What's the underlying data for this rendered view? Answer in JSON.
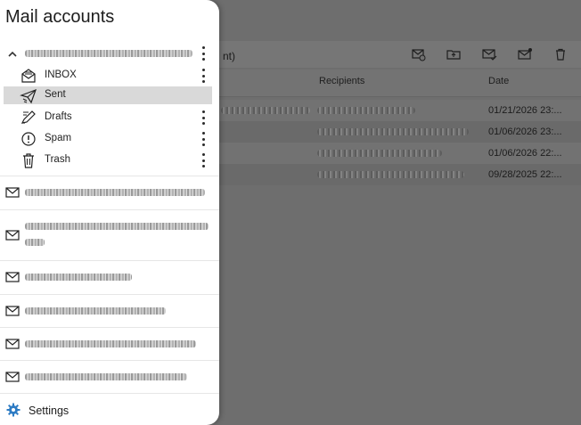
{
  "drawer": {
    "title": "Mail accounts",
    "primary_account": {
      "folders": [
        {
          "label": "INBOX",
          "icon": "inbox-icon"
        },
        {
          "label": "Sent",
          "icon": "sent-icon",
          "selected": true
        },
        {
          "label": "Drafts",
          "icon": "drafts-icon"
        },
        {
          "label": "Spam",
          "icon": "spam-icon"
        },
        {
          "label": "Trash",
          "icon": "trash-icon"
        }
      ]
    },
    "other_accounts_count": 6,
    "settings_label": "Settings",
    "settings_icon": "gear-icon"
  },
  "background": {
    "folder_title_fragment": "nt)",
    "toolbar_icons": [
      "move-to-junk-icon",
      "move-to-folder-icon",
      "mark-read-icon",
      "mark-unread-icon",
      "delete-icon"
    ],
    "columns": {
      "recipients": "Recipients",
      "date": "Date"
    },
    "rows": [
      {
        "date": "01/21/2026 23:..."
      },
      {
        "date": "01/06/2026 23:..."
      },
      {
        "date": "01/06/2026 22:..."
      },
      {
        "date": "09/28/2025 22:..."
      }
    ]
  },
  "colors": {
    "selected_row": "#d9d9d9",
    "settings_icon": "#2e7cc4",
    "scrim": "#6e6e6e"
  }
}
